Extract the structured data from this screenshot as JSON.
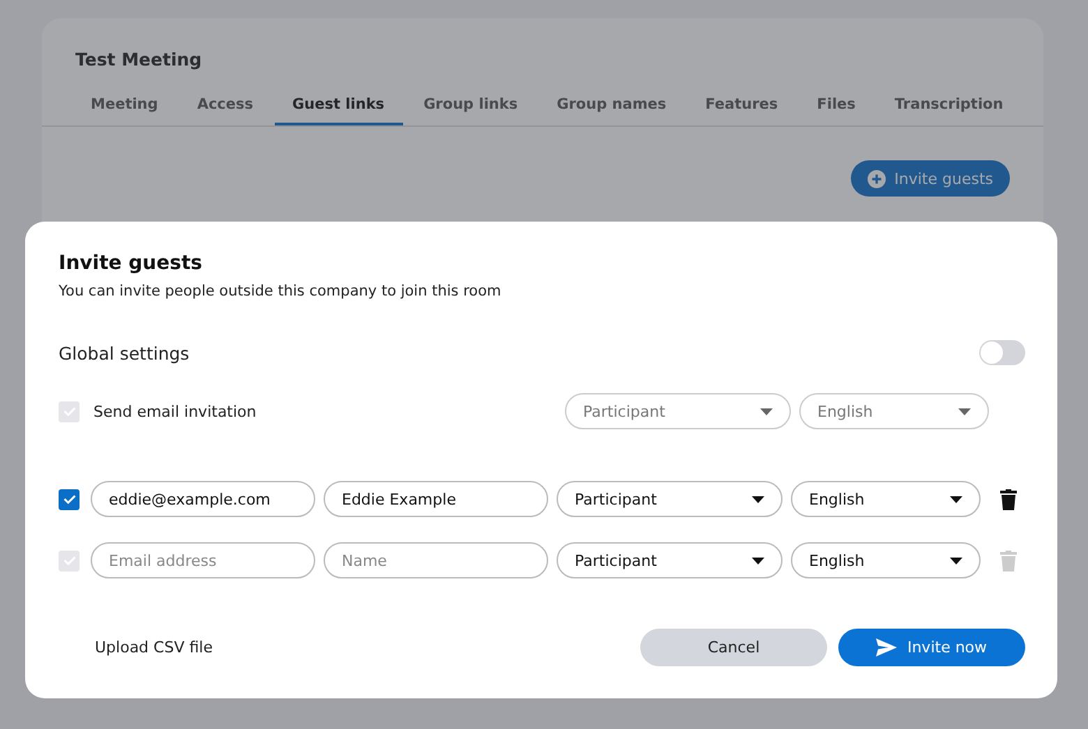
{
  "meeting": {
    "title": "Test Meeting",
    "tabs": [
      {
        "label": "Meeting",
        "selected": false
      },
      {
        "label": "Access",
        "selected": false
      },
      {
        "label": "Guest links",
        "selected": true
      },
      {
        "label": "Group links",
        "selected": false
      },
      {
        "label": "Group names",
        "selected": false
      },
      {
        "label": "Features",
        "selected": false
      },
      {
        "label": "Files",
        "selected": false
      },
      {
        "label": "Transcription",
        "selected": false
      }
    ],
    "invite_button": "Invite guests"
  },
  "dialog": {
    "title": "Invite guests",
    "subtitle": "You can invite people outside this company to join this room",
    "global_settings": {
      "label": "Global settings",
      "on": false,
      "send_email": {
        "label": "Send email invitation",
        "checked": true,
        "disabled": true
      },
      "role": {
        "value": "Participant",
        "disabled": true
      },
      "language": {
        "value": "English",
        "disabled": true
      }
    },
    "guests": [
      {
        "checked": true,
        "disabled": false,
        "email": {
          "value": "eddie@example.com"
        },
        "name": {
          "value": "Eddie Example"
        },
        "role": "Participant",
        "language": "English",
        "delete_disabled": false
      },
      {
        "checked": true,
        "disabled": true,
        "email": {
          "placeholder": "Email address"
        },
        "name": {
          "placeholder": "Name"
        },
        "role": "Participant",
        "language": "English",
        "delete_disabled": true
      }
    ],
    "upload_link": "Upload CSV file",
    "cancel_button": "Cancel",
    "submit_button": "Invite now"
  }
}
